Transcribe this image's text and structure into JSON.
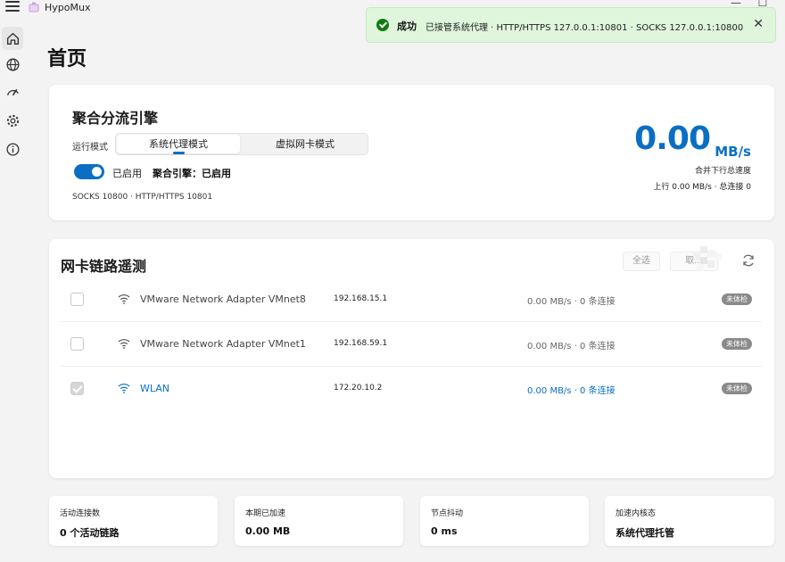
{
  "app": {
    "title": "HypoMux",
    "window_controls": [
      "—",
      "☐"
    ]
  },
  "sidebar": {
    "items": [
      {
        "name": "home",
        "icon": "home-icon",
        "active": true
      },
      {
        "name": "globe",
        "icon": "globe-icon"
      },
      {
        "name": "speed",
        "icon": "speedometer-icon"
      },
      {
        "name": "settings",
        "icon": "gear-icon"
      },
      {
        "name": "about",
        "icon": "info-icon"
      }
    ]
  },
  "page": {
    "title": "首页"
  },
  "engine": {
    "title": "聚合分流引擎",
    "mode_label": "运行模式",
    "modes": [
      "系统代理模式",
      "虚拟网卡模式"
    ],
    "selected_mode": "系统代理模式",
    "toggle_label": "已启用",
    "toggle_on": true,
    "status": "聚合引擎：已启用",
    "ports": "SOCKS 10800 · HTTP/HTTPS 10801",
    "speed_value": "0.00",
    "speed_unit": "MB/s",
    "speed_desc": "合并下行总速度",
    "speed_sub": "上行 0.00 MB/s · 总连接 0"
  },
  "links": {
    "title": "网卡链路遥测",
    "select_all": "全选",
    "other_button": "取...",
    "adapters": [
      {
        "name": "VMware Network Adapter VMnet8",
        "ip": "192.168.15.1",
        "speed": "0.00 MB/s · 0 条连接",
        "badge": "未体检",
        "checked": false,
        "highlight": false
      },
      {
        "name": "VMware Network Adapter VMnet1",
        "ip": "192.168.59.1",
        "speed": "0.00 MB/s · 0 条连接",
        "badge": "未体检",
        "checked": false,
        "highlight": false
      },
      {
        "name": "WLAN",
        "ip": "172.20.10.2",
        "speed": "0.00 MB/s · 0 条连接",
        "badge": "未体检",
        "checked": true,
        "highlight": true
      }
    ]
  },
  "stats": [
    {
      "label": "活动连接数",
      "value": "0 个活动链路"
    },
    {
      "label": "本期已加速",
      "value": "0.00 MB"
    },
    {
      "label": "节点抖动",
      "value": "0 ms"
    },
    {
      "label": "加速内核态",
      "value": "系统代理托管"
    }
  ],
  "toast": {
    "title": "成功",
    "message": "已接管系统代理 · HTTP/HTTPS 127.0.0.1:10801 · SOCKS 127.0.0.1:10800",
    "close": "✕"
  },
  "colors": {
    "accent": "#0a6fc2",
    "success_bg": "#dff6dd",
    "success_icon": "#107c10",
    "badge": "#8a8a8a"
  }
}
